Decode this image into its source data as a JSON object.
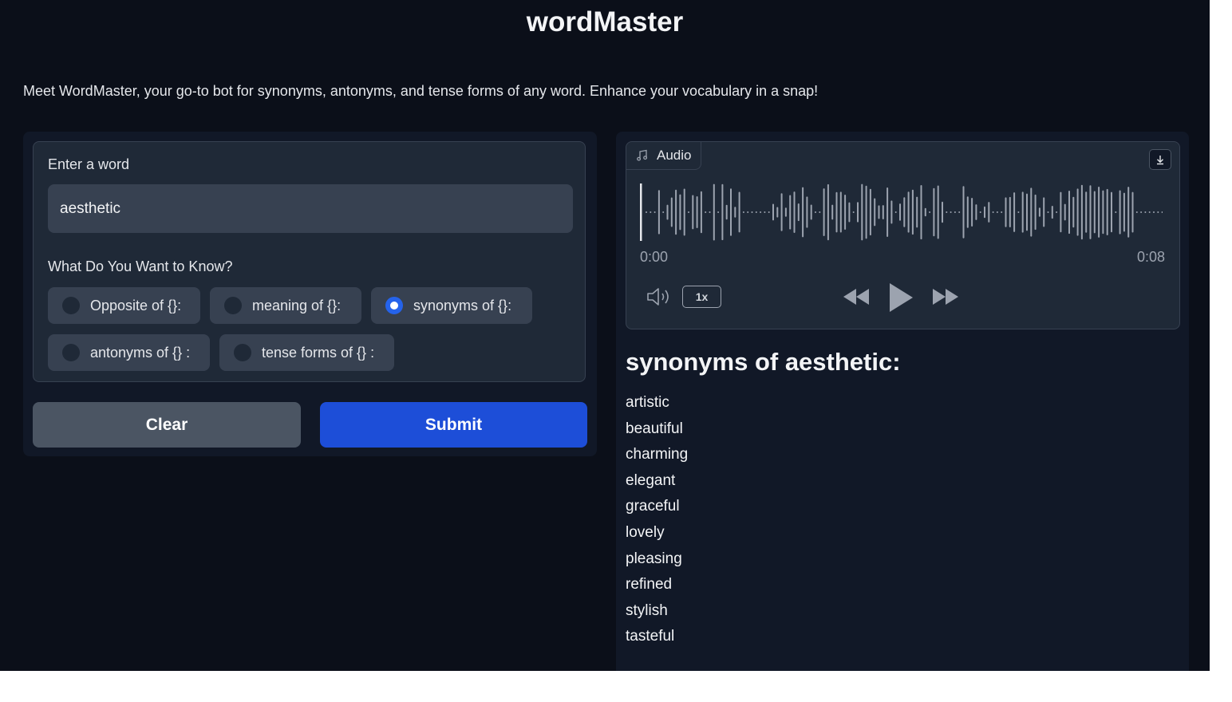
{
  "app": {
    "title": "wordMaster",
    "description": "Meet WordMaster, your go-to bot for synonyms, antonyms, and tense forms of any word. Enhance your vocabulary in a snap!"
  },
  "input": {
    "label": "Enter a word",
    "value": "aesthetic"
  },
  "question": {
    "label": "What Do You Want to Know?",
    "options": [
      {
        "label": "Opposite of {}:",
        "selected": false
      },
      {
        "label": "meaning of {}:",
        "selected": false
      },
      {
        "label": "synonyms of {}:",
        "selected": true
      },
      {
        "label": "antonyms of {} :",
        "selected": false
      },
      {
        "label": "tense forms of {} :",
        "selected": false
      }
    ]
  },
  "buttons": {
    "clear": "Clear",
    "submit": "Submit"
  },
  "audio": {
    "label": "Audio",
    "current_time": "0:00",
    "total_time": "0:08",
    "speed": "1x"
  },
  "result": {
    "heading": "synonyms of aesthetic:",
    "items": [
      "artistic",
      "beautiful",
      "charming",
      "elegant",
      "graceful",
      "lovely",
      "pleasing",
      "refined",
      "stylish",
      "tasteful"
    ]
  },
  "colors": {
    "background": "#0b0f19",
    "panel": "#111827",
    "block": "#1f2937",
    "primary": "#1d4ed8",
    "secondary": "#4b5563",
    "selected_radio": "#2563eb"
  },
  "icons": {
    "audio_tab": "music-note-icon",
    "download": "download-icon",
    "volume": "volume-icon",
    "rewind": "rewind-icon",
    "play": "play-icon",
    "fast_forward": "fast-forward-icon"
  }
}
